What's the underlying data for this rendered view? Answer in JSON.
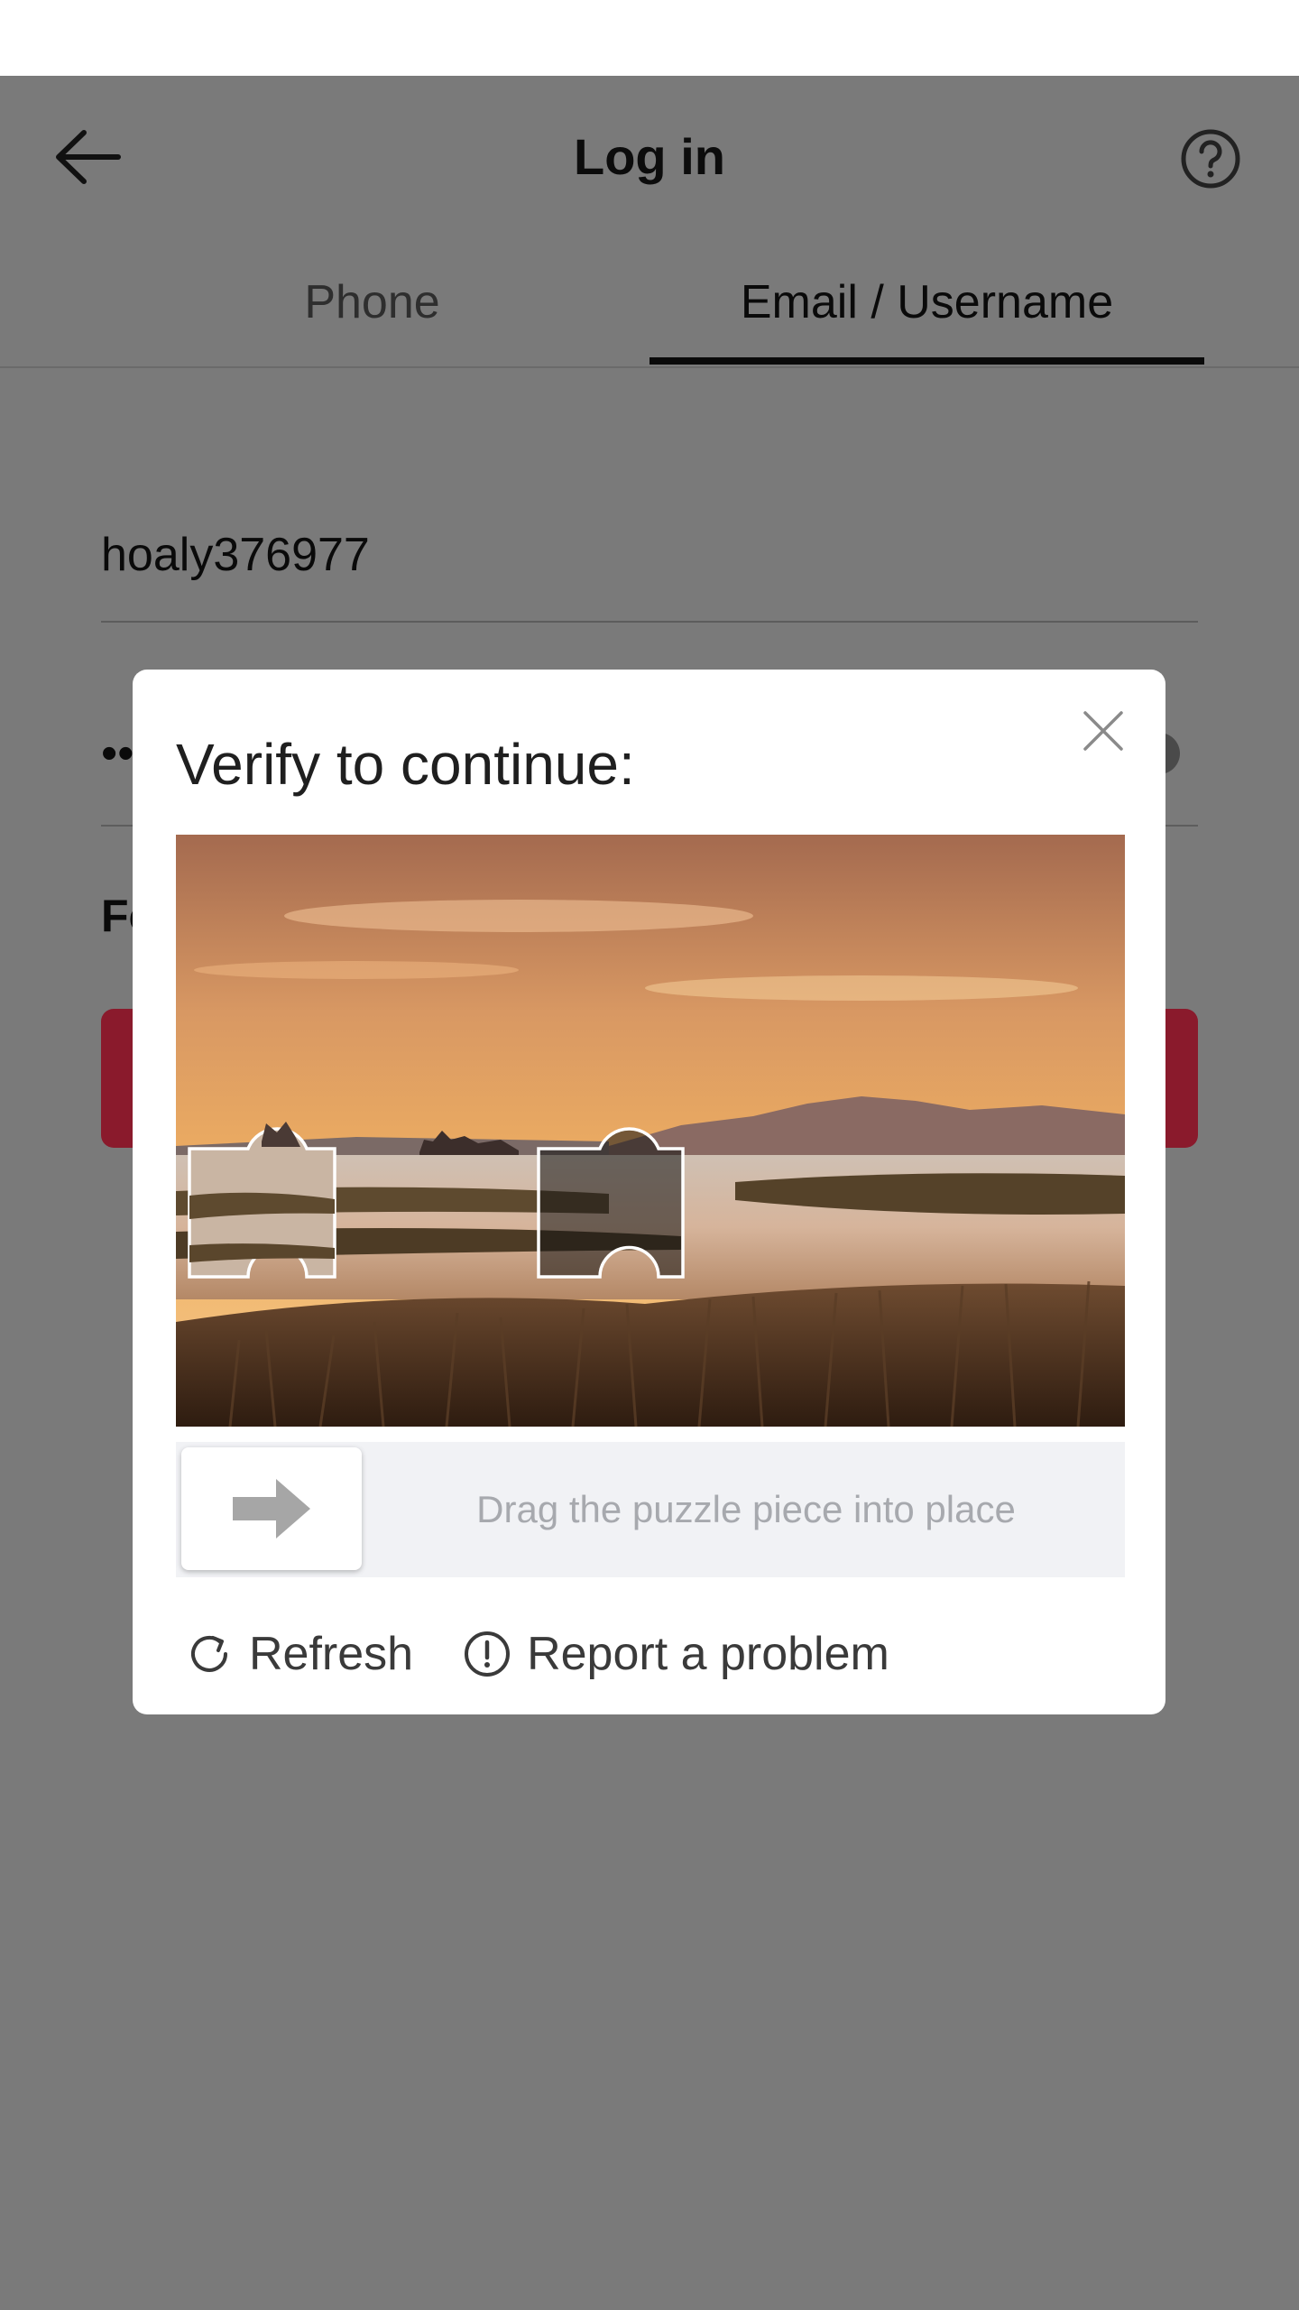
{
  "header": {
    "title": "Log in",
    "back_icon": "arrow-left-icon",
    "help_icon": "question-circle-icon"
  },
  "tabs": [
    {
      "label": "Phone",
      "active": false
    },
    {
      "label": "Email / Username",
      "active": true
    }
  ],
  "form": {
    "username_value": "hoaly376977",
    "password_value": "••",
    "forgot_label_visible": "Fo"
  },
  "modal": {
    "title": "Verify to continue:",
    "close_icon": "close-icon",
    "puzzle_image": "sunset-marsh-puzzle",
    "slider": {
      "handle_icon": "arrow-right-icon",
      "hint": "Drag the puzzle piece into place"
    },
    "actions": {
      "refresh_label": "Refresh",
      "refresh_icon": "refresh-icon",
      "report_label": "Report a problem",
      "report_icon": "alert-circle-icon"
    }
  },
  "colors": {
    "overlay": "#7a7a7a",
    "brand_button": "#8a1a2c",
    "slider_track": "#f1f2f5"
  }
}
